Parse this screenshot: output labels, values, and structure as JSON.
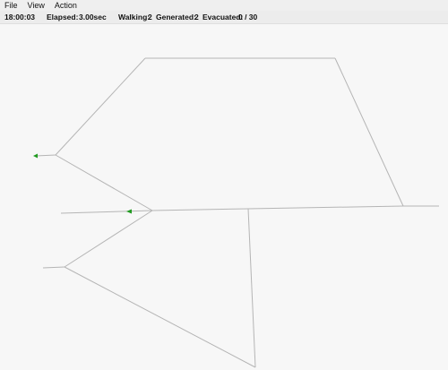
{
  "menu": {
    "file": "File",
    "view": "View",
    "action": "Action"
  },
  "status": {
    "clock": "18:00:03",
    "elapsed_label": "Elapsed:",
    "elapsed_value": "3.00sec",
    "walking_label": "Walking:",
    "walking_value": "2",
    "generated_label": "Generated:",
    "generated_value": "2",
    "evacuated_label": "Evacuated:",
    "evacuated_value": "0 / 30"
  },
  "colors": {
    "background": "#f7f7f7",
    "link": "#b5b5b5",
    "agent": "#1f9a1f"
  },
  "agents": {
    "walking_count": 2
  }
}
